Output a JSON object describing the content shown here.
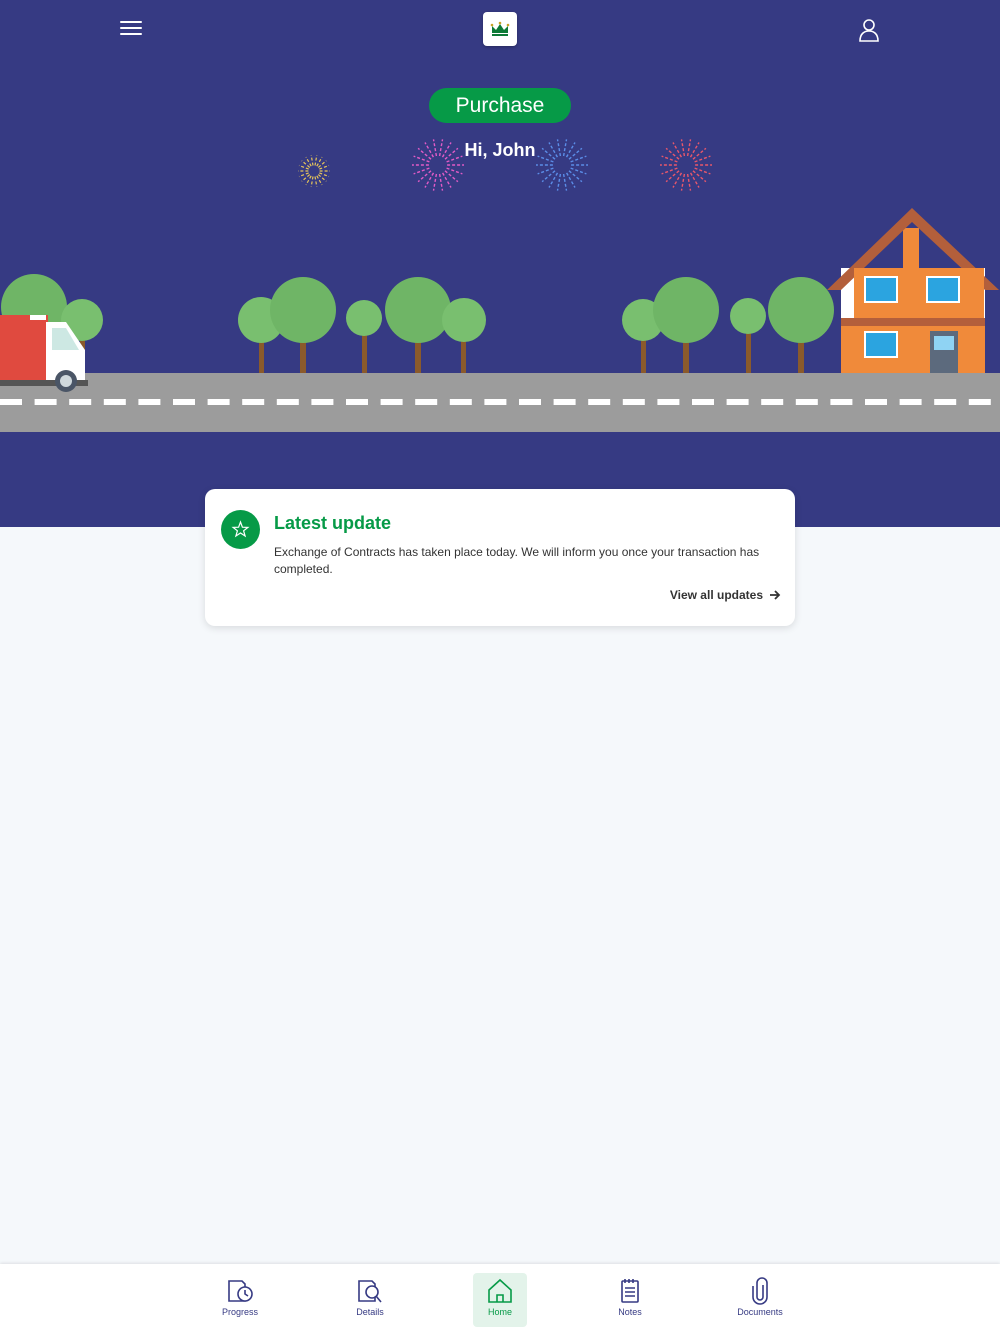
{
  "header": {
    "logo_icon": "crown-logo-icon",
    "menu_icon": "hamburger-menu-icon",
    "profile_icon": "user-profile-icon"
  },
  "hero": {
    "badge_label": "Purchase",
    "greeting": "Hi, John",
    "background_color": "#363a83"
  },
  "latest_update": {
    "title": "Latest update",
    "message": "Exchange of Contracts has taken place today. We will inform you once your transaction has completed.",
    "link_label": "View all updates",
    "icon": "star-badge-icon"
  },
  "bottom_nav": {
    "items": [
      {
        "label": "Progress",
        "icon": "progress-clock-icon"
      },
      {
        "label": "Details",
        "icon": "details-search-icon"
      },
      {
        "label": "Home",
        "icon": "home-icon",
        "active": true
      },
      {
        "label": "Notes",
        "icon": "notes-icon"
      },
      {
        "label": "Documents",
        "icon": "paperclip-icon"
      }
    ]
  },
  "colors": {
    "brand_navy": "#363a83",
    "brand_green": "#069a47",
    "page_background": "#f5f8fb"
  }
}
